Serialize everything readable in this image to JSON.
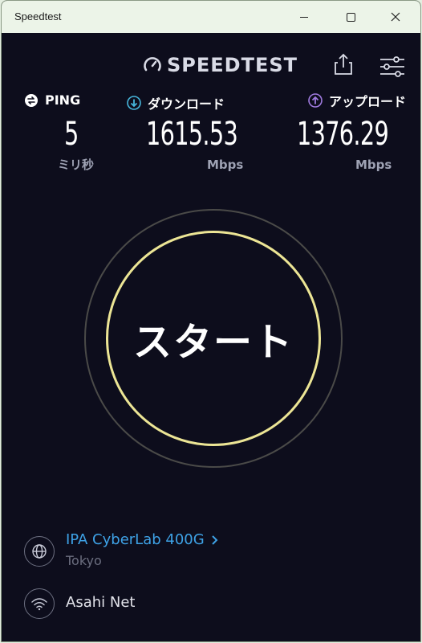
{
  "window": {
    "title": "Speedtest"
  },
  "header": {
    "logo_text": "SPEEDTEST"
  },
  "stats": {
    "ping": {
      "label": "PING",
      "value": "5",
      "unit": "ミリ秒"
    },
    "download": {
      "label": "ダウンロード",
      "value": "1615.53",
      "unit": "Mbps"
    },
    "upload": {
      "label": "アップロード",
      "value": "1376.29",
      "unit": "Mbps"
    }
  },
  "start": {
    "label": "スタート"
  },
  "server": {
    "name": "IPA CyberLab 400G",
    "location": "Tokyo"
  },
  "isp": {
    "name": "Asahi Net"
  },
  "icons": {
    "minimize": "minimize-icon",
    "maximize": "maximize-icon",
    "close": "close-icon",
    "gauge": "gauge-icon",
    "share": "share-icon",
    "settings": "settings-sliders-icon",
    "ping": "ping-icon",
    "download": "download-arrow-icon",
    "upload": "upload-arrow-icon",
    "globe": "globe-icon",
    "wifi": "wifi-icon",
    "chevron": "chevron-right-icon"
  },
  "colors": {
    "background": "#0d0d1c",
    "accent_ring": "#ece595",
    "download_accent": "#47b7dd",
    "upload_accent": "#a07be0",
    "link": "#3ea2e6"
  }
}
